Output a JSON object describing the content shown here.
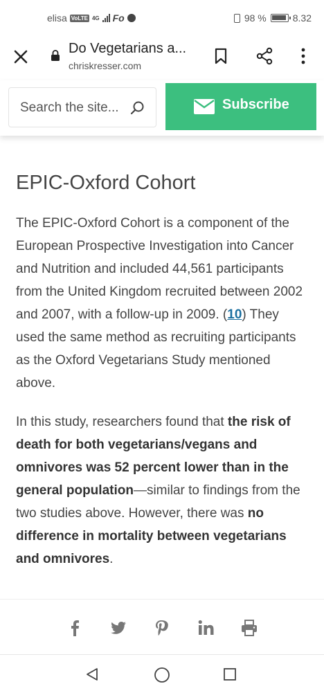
{
  "status_bar": {
    "carrier": "elisa",
    "volte": "VoLTE",
    "network": "4G",
    "app_icon_text": "Fo",
    "battery_percent": "98 %",
    "time": "8.32"
  },
  "browser": {
    "page_title": "Do Vegetarians a...",
    "domain": "chriskresser.com",
    "icons": [
      "close-icon",
      "lock-icon",
      "bookmark-icon",
      "share-icon",
      "more-icon"
    ]
  },
  "toolbar": {
    "search_placeholder": "Search the site...",
    "subscribe_label": "Subscribe",
    "subscribe_color": "#3cbf7f"
  },
  "article": {
    "heading": "EPIC-Oxford Cohort",
    "para1_before": "The EPIC-Oxford Cohort is a component of the European Prospective Investigation into Cancer and Nutrition and included 44,561 participants from the United Kingdom recruited between 2002 and 2007, with a follow-up in 2009. (",
    "para1_ref": "10",
    "para1_after": ") They used the same method as recruiting participants as the Oxford Vegetarians Study mentioned above.",
    "para2_a": "In this study, researchers found that ",
    "para2_b_bold": "the risk of death for both vegetarians/vegans and omnivores was 52 percent lower than in the general population",
    "para2_c": "—similar to findings from the two studies above. However, there was ",
    "para2_d_bold": "no difference in mortality between vegetarians and omnivores",
    "para2_e": ".",
    "link_color": "#1a6fa0"
  },
  "share_icons": [
    "facebook-icon",
    "twitter-icon",
    "pinterest-icon",
    "linkedin-icon",
    "print-icon"
  ],
  "nav_buttons": [
    "back",
    "home",
    "recent-apps"
  ]
}
